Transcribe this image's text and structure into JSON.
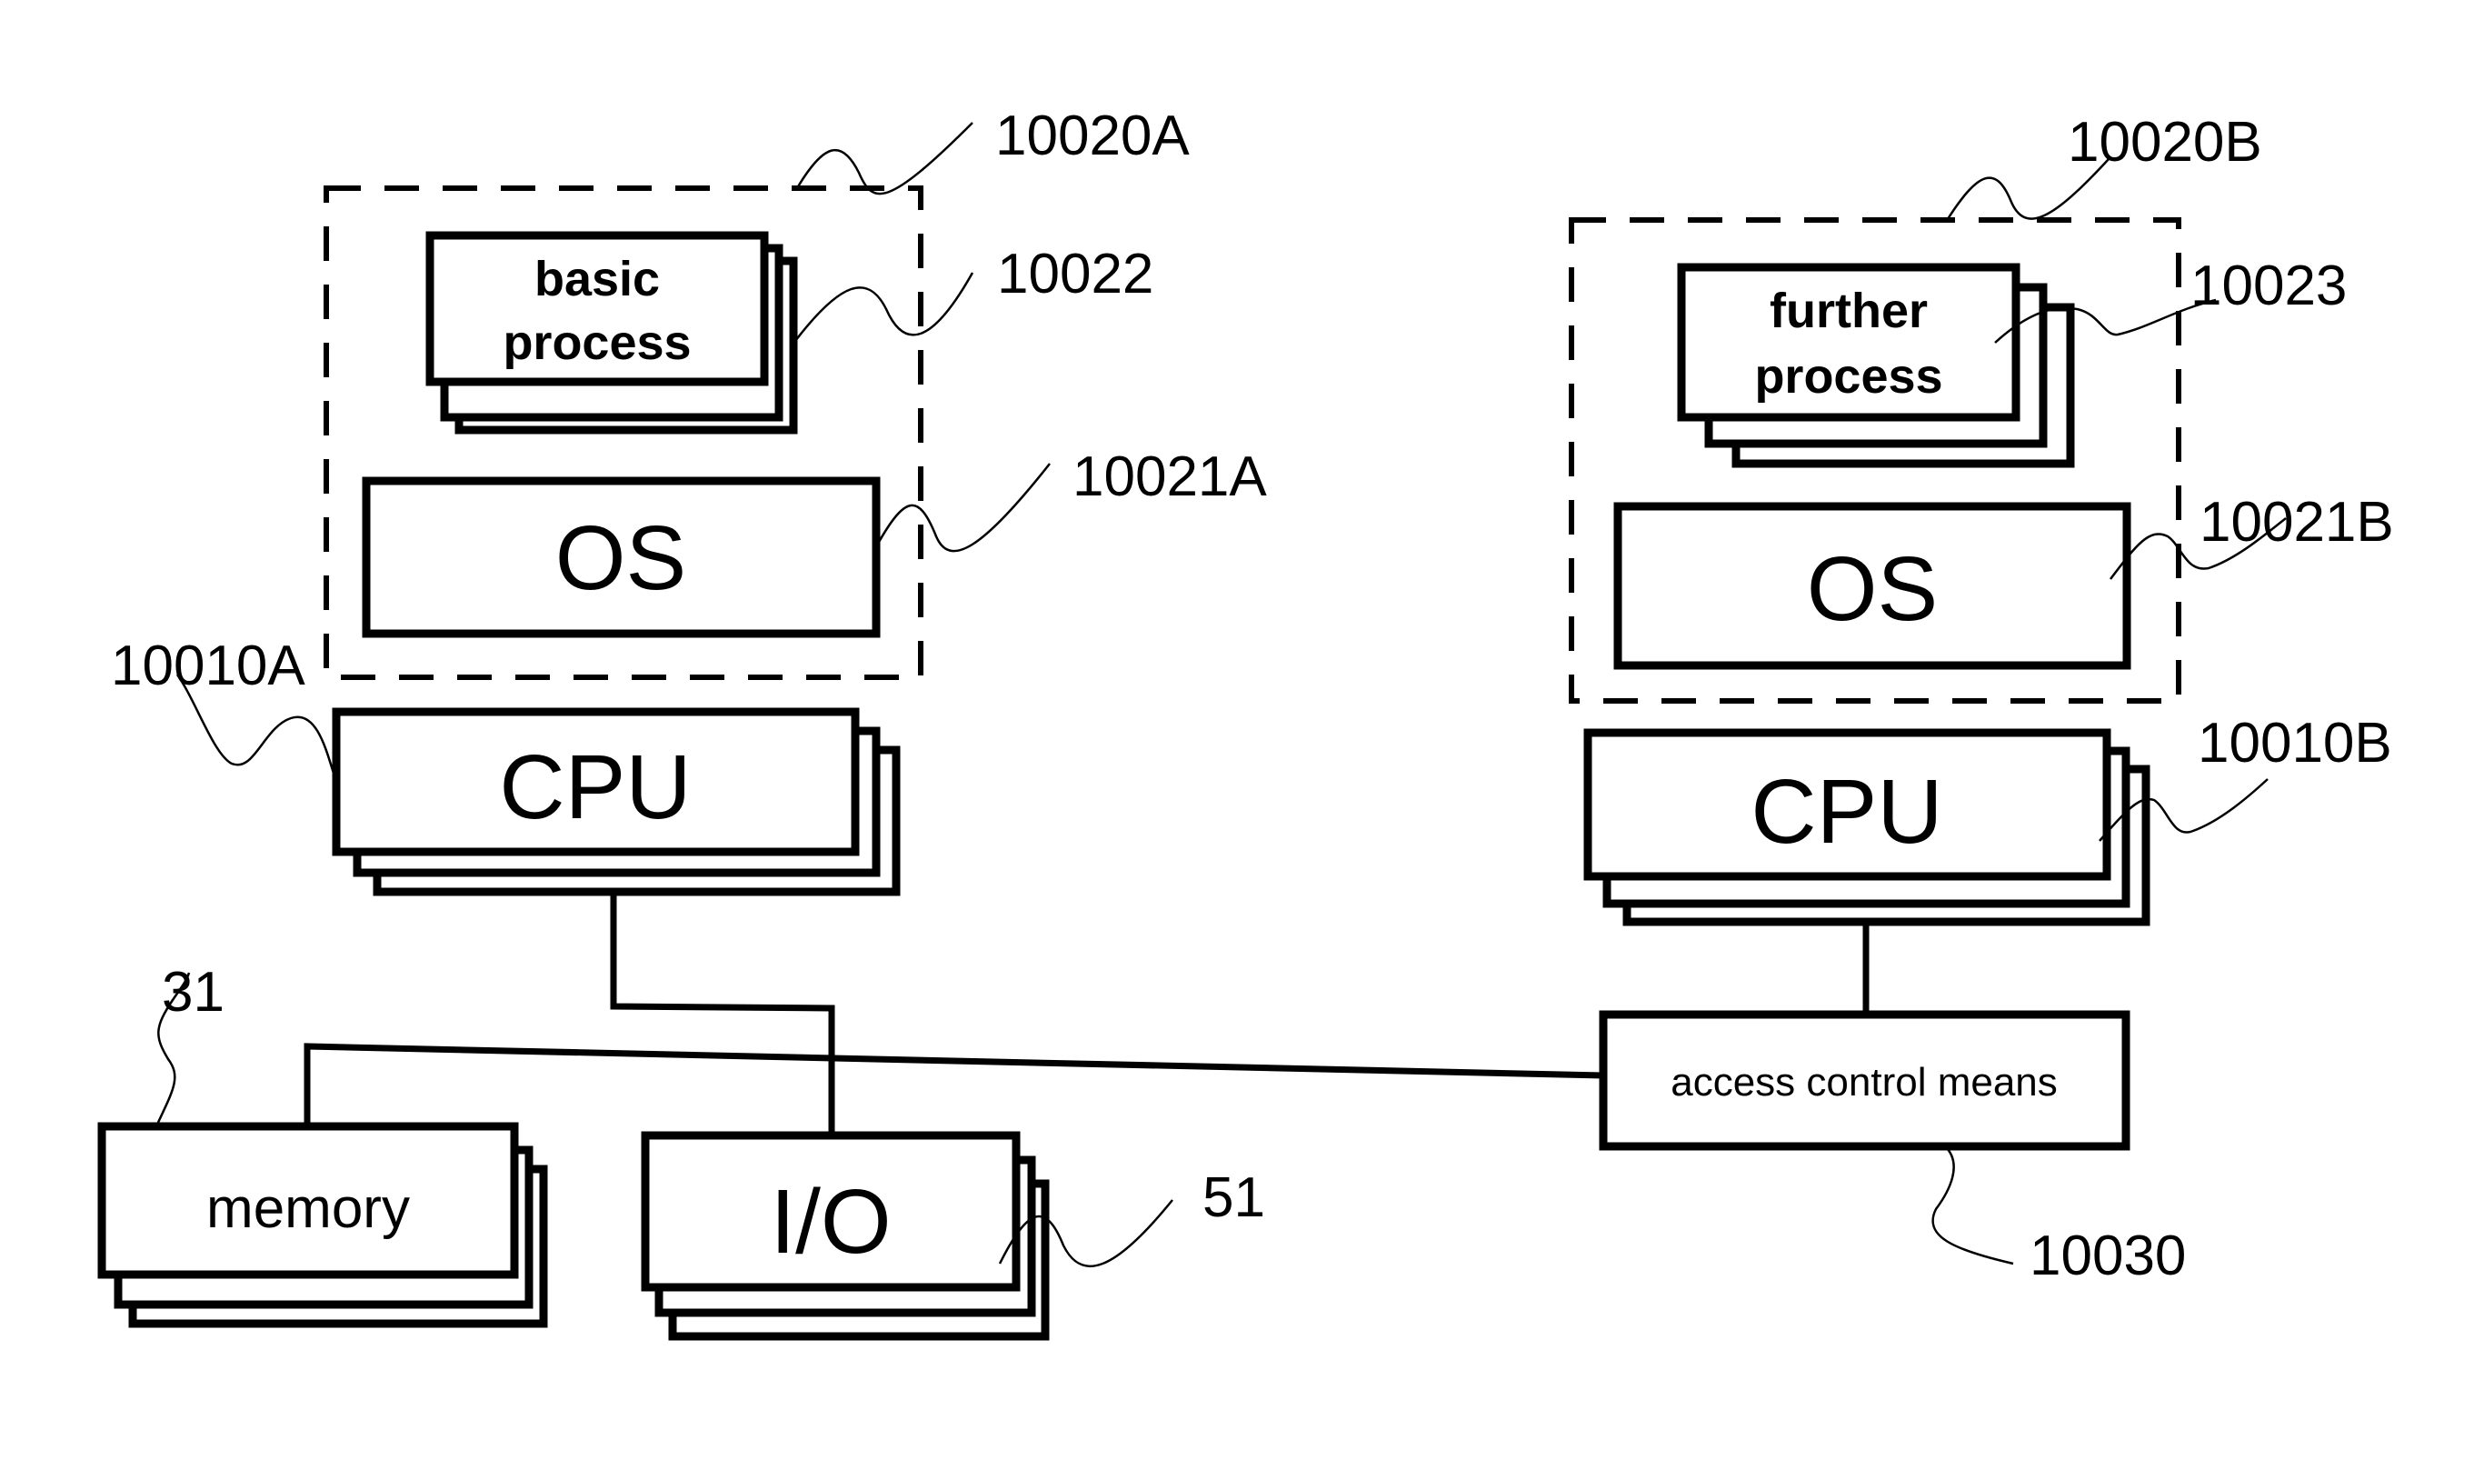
{
  "diagram": {
    "node_a": {
      "group_ref": "10020A",
      "process": {
        "line1": "basic",
        "line2": "process",
        "ref": "10022"
      },
      "os": {
        "label": "OS",
        "ref": "10021A"
      },
      "cpu": {
        "label": "CPU",
        "ref": "10010A"
      }
    },
    "node_b": {
      "group_ref": "10020B",
      "process": {
        "line1": "further",
        "line2": "process",
        "ref": "10023"
      },
      "os": {
        "label": "OS",
        "ref": "10021B"
      },
      "cpu": {
        "label": "CPU",
        "ref": "10010B"
      }
    },
    "memory": {
      "label": "memory",
      "ref": "31"
    },
    "io": {
      "label": "I/O",
      "ref": "51"
    },
    "access_control": {
      "label": "access control means",
      "ref": "10030"
    },
    "colors": {
      "stroke": "#000000",
      "background": "#ffffff"
    }
  }
}
